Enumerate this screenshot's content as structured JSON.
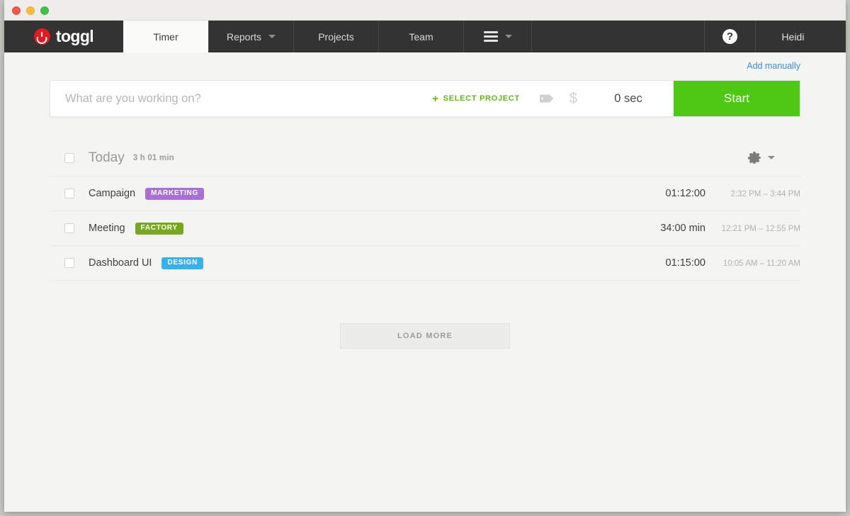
{
  "window": {
    "traffic_lights": [
      "close",
      "minimize",
      "zoom"
    ]
  },
  "navbar": {
    "brand_label": "toggl",
    "tabs": [
      {
        "label": "Timer",
        "active": true,
        "has_caret": false
      },
      {
        "label": "Reports",
        "active": false,
        "has_caret": true
      },
      {
        "label": "Projects",
        "active": false,
        "has_caret": false
      },
      {
        "label": "Team",
        "active": false,
        "has_caret": false
      }
    ],
    "menu_icon": "hamburger-icon",
    "help_icon_label": "?",
    "user_name": "Heidi"
  },
  "toolbar": {
    "add_manually_label": "Add manually"
  },
  "timer": {
    "placeholder": "What are you working on?",
    "select_project_label": "SELECT PROJECT",
    "plus_label": "+",
    "tag_icon": "tag-icon",
    "billable_icon": "dollar-icon",
    "elapsed": "0 sec",
    "start_label": "Start"
  },
  "day_group": {
    "title": "Today",
    "total": "3 h 01 min",
    "settings_icon": "gear-icon"
  },
  "entries": [
    {
      "title": "Campaign",
      "project": "MARKETING",
      "project_color": "#a86fd4",
      "duration": "01:12:00",
      "timespan": "2:32 PM – 3:44 PM"
    },
    {
      "title": "Meeting",
      "project": "FACTORY",
      "project_color": "#77a81f",
      "duration": "34:00 min",
      "timespan": "12:21 PM – 12:55 PM"
    },
    {
      "title": "Dashboard UI",
      "project": "DESIGN",
      "project_color": "#39b0e8",
      "duration": "01:15:00",
      "timespan": "10:05 AM – 11:20 AM"
    }
  ],
  "footer": {
    "load_more_label": "LOAD MORE"
  },
  "colors": {
    "navbar_bg": "#333333",
    "start_green": "#4ec715",
    "link_blue": "#3a8ed0",
    "select_project_green": "#60b516",
    "page_bg": "#f4f4f2"
  }
}
